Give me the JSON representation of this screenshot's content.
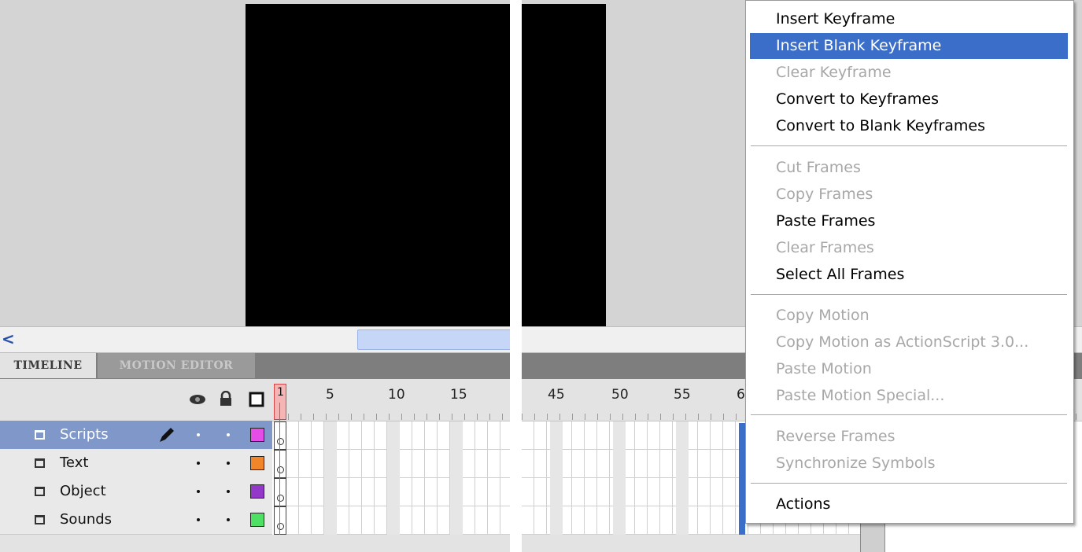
{
  "timeline": {
    "tabs": [
      {
        "label": "TIMELINE",
        "active": true
      },
      {
        "label": "MOTION EDITOR",
        "active": false
      }
    ],
    "header_icons": [
      "eye-icon",
      "lock-icon",
      "outline-square-icon"
    ],
    "playhead_frame": "1",
    "ruler_left": [
      "5",
      "10",
      "15"
    ],
    "ruler_right": [
      "45",
      "50",
      "55",
      "6"
    ],
    "layers": [
      {
        "name": "Scripts",
        "selected": true,
        "color": "#e64de6"
      },
      {
        "name": "Text",
        "selected": false,
        "color": "#f0852a"
      },
      {
        "name": "Object",
        "selected": false,
        "color": "#9338c8"
      },
      {
        "name": "Sounds",
        "selected": false,
        "color": "#4de064"
      }
    ],
    "scroll_left_arrow": "<"
  },
  "context_menu": {
    "items": [
      {
        "label": "Insert Keyframe",
        "enabled": true
      },
      {
        "label": "Insert Blank Keyframe",
        "enabled": true,
        "highlighted": true
      },
      {
        "label": "Clear Keyframe",
        "enabled": false
      },
      {
        "label": "Convert to Keyframes",
        "enabled": true
      },
      {
        "label": "Convert to Blank Keyframes",
        "enabled": true
      },
      {
        "label": "Cut Frames",
        "enabled": false
      },
      {
        "label": "Copy Frames",
        "enabled": false
      },
      {
        "label": "Paste Frames",
        "enabled": true
      },
      {
        "label": "Clear Frames",
        "enabled": false
      },
      {
        "label": "Select All Frames",
        "enabled": true
      },
      {
        "label": "Copy Motion",
        "enabled": false
      },
      {
        "label": "Copy Motion as ActionScript 3.0...",
        "enabled": false
      },
      {
        "label": "Paste Motion",
        "enabled": false
      },
      {
        "label": "Paste Motion Special...",
        "enabled": false
      },
      {
        "label": "Reverse Frames",
        "enabled": false
      },
      {
        "label": "Synchronize Symbols",
        "enabled": false
      },
      {
        "label": "Actions",
        "enabled": true
      }
    ]
  },
  "colors": {
    "menu_highlight": "#3a6ec8",
    "selected_layer": "#7f98c9",
    "playhead": "#e24b4b"
  }
}
